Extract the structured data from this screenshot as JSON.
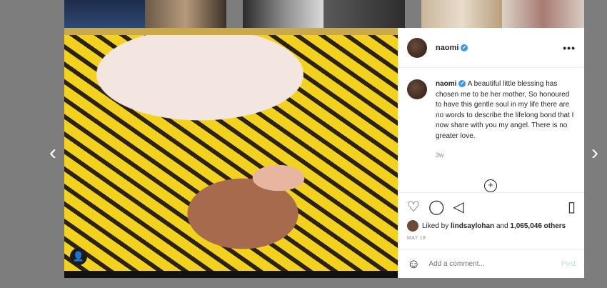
{
  "nav": {
    "prev_glyph": "‹",
    "next_glyph": "›"
  },
  "post": {
    "username": "naomi",
    "verified_glyph": "✓",
    "more_glyph": "•••",
    "caption": "A beautiful little blessing has chosen me to be her mother, So honoured to have this gentle soul in my life there are no words to describe the lifelong bond that I now share with you my angel. There is no greater love.",
    "time_ago": "3w",
    "load_more_glyph": "+",
    "likes_prefix": "Liked by",
    "liked_by_user": "lindsaylohan",
    "likes_and": "and",
    "likes_count": "1,065,046 others",
    "date": "MAY 18"
  },
  "icons": {
    "like": "♡",
    "comment": "◯",
    "share": "◁",
    "save": "▯",
    "emoji": "☺",
    "tag": "👤"
  },
  "comment_box": {
    "placeholder": "Add a comment...",
    "post_label": "Post"
  },
  "colors": {
    "accent": "#3897f0",
    "post_disabled": "#b2dffc"
  }
}
